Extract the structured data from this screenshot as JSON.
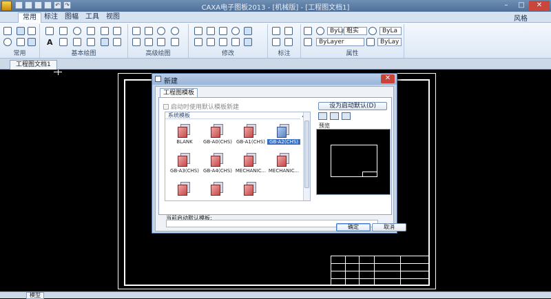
{
  "window": {
    "title": "CAXA电子图板2013 - [机械版] - [工程图文档1]",
    "controls": [
      "–",
      "□",
      "✕"
    ]
  },
  "menu_tabs": [
    "常用",
    "标注",
    "图幅",
    "工具",
    "视图"
  ],
  "style_label": "风格",
  "ribbon": {
    "groups": [
      "常用",
      "基本绘图",
      "高级绘图",
      "修改",
      "标注",
      "属性"
    ],
    "text_icon": "A",
    "layer_dd_1": "ByLa",
    "layer_dd_2": "ByLa",
    "color_dd": "粗实",
    "linetype_dd": "ByLayer",
    "lineweight_dd": "ByLay"
  },
  "doc_tab": "工程图文档1",
  "layout_tab": "模型",
  "dialog": {
    "title": "新建",
    "tab": "工程图模板",
    "use_default_checkbox": "启动时使用默认模板新建",
    "section_header": "系统模板",
    "templates": [
      {
        "label": "BLANK",
        "selected": false
      },
      {
        "label": "GB-A0(CHS)",
        "selected": false
      },
      {
        "label": "GB-A1(CHS)",
        "selected": false
      },
      {
        "label": "GB-A2(CHS)",
        "selected": true
      },
      {
        "label": "GB-A3(CHS)",
        "selected": false
      },
      {
        "label": "GB-A4(CHS)",
        "selected": false
      },
      {
        "label": "MECHANIC...",
        "selected": false
      },
      {
        "label": "MECHANIC...",
        "selected": false
      },
      {
        "label": "",
        "selected": false
      },
      {
        "label": "",
        "selected": false
      },
      {
        "label": "",
        "selected": false
      }
    ],
    "set_default_button": "设为启动默认(D)",
    "preview_label": "预览",
    "current_default_label": "当前启动默认模板:",
    "current_default_value": "",
    "ok_button": "确定",
    "cancel_button": "取消",
    "close_glyph": "✕"
  },
  "colors": {
    "titlebar": "#5a7ba6",
    "canvas": "#000000",
    "dialog_bg": "#c3d3e6",
    "selection": "#3a6fc4"
  }
}
